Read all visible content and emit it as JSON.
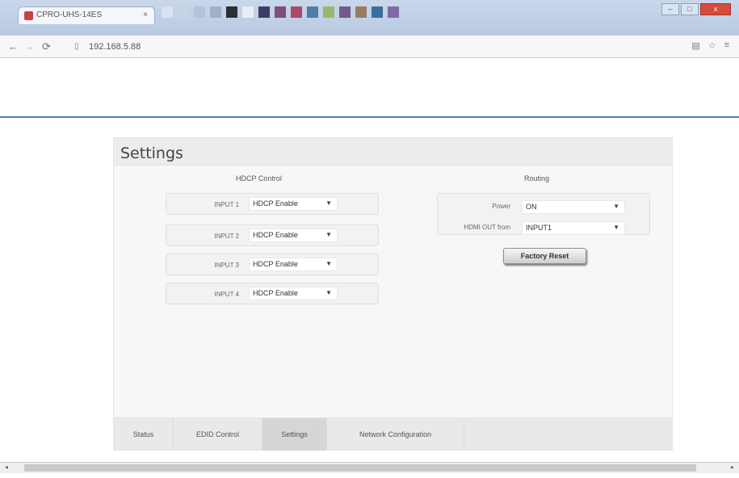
{
  "browser": {
    "tab_title": "CPRO-UHS-14ES",
    "tab_close": "×",
    "url": "192.168.5.88",
    "window_controls": {
      "minimize": "–",
      "maximize": "□",
      "close": "x"
    }
  },
  "page": {
    "title": "Settings",
    "hdcp": {
      "title": "HDCP Control",
      "rows": [
        {
          "label": "INPUT 1",
          "value": "HDCP Enable"
        },
        {
          "label": "INPUT 2",
          "value": "HDCP Enable"
        },
        {
          "label": "INPUT 3",
          "value": "HDCP Enable"
        },
        {
          "label": "INPUT 4",
          "value": "HDCP Enable"
        }
      ]
    },
    "routing": {
      "title": "Routing",
      "power_label": "Power",
      "power_value": "ON",
      "hdmi_label": "HDMI OUT from",
      "hdmi_value": "INPUT1"
    },
    "factory_reset": "Factory Reset",
    "tabs": [
      "Status",
      "EDID Control",
      "Settings",
      "Network Configuration"
    ]
  },
  "icons": {
    "back": "back-arrow-icon",
    "forward": "forward-arrow-icon",
    "reload": "reload-icon",
    "page": "page-icon",
    "star": "star-icon",
    "menu": "menu-icon"
  }
}
